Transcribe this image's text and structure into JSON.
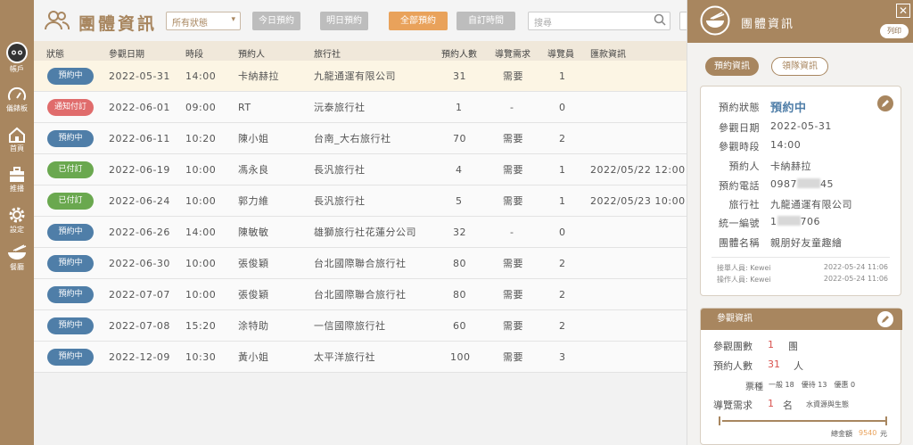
{
  "sidebar": {
    "items": [
      {
        "label": "帳戶"
      },
      {
        "label": "儀錶板"
      },
      {
        "label": "首頁"
      },
      {
        "label": "推播"
      },
      {
        "label": "設定"
      },
      {
        "label": "餐廳"
      }
    ]
  },
  "header": {
    "title": "團體資訊",
    "status_filter": "所有狀態",
    "filters": [
      "今日預約",
      "明日預約",
      "全部預約",
      "自訂時間"
    ],
    "search_placeholder": "搜尋"
  },
  "table": {
    "columns": [
      "狀態",
      "參觀日期",
      "時段",
      "預約人",
      "旅行社",
      "預約人數",
      "導覽需求",
      "導覽員",
      "匯款資訊"
    ],
    "rows": [
      {
        "status": "預約中",
        "status_color": "#4f7ea8",
        "date": "2022-05-31",
        "time": "14:00",
        "person": "卡納赫拉",
        "agency": "九龍通運有限公司",
        "count": "31",
        "guide_need": "需要",
        "guides": "1",
        "remit": ""
      },
      {
        "status": "通知付訂",
        "status_color": "#e06c6c",
        "date": "2022-06-01",
        "time": "09:00",
        "person": "RT",
        "agency": "沅泰旅行社",
        "count": "1",
        "guide_need": "-",
        "guides": "0",
        "remit": ""
      },
      {
        "status": "預約中",
        "status_color": "#4f7ea8",
        "date": "2022-06-11",
        "time": "10:20",
        "person": "陳小姐",
        "agency": "台南_大右旅行社",
        "count": "70",
        "guide_need": "需要",
        "guides": "2",
        "remit": ""
      },
      {
        "status": "已付訂",
        "status_color": "#6aa84f",
        "date": "2022-06-19",
        "time": "10:00",
        "person": "馮永良",
        "agency": "長汎旅行社",
        "count": "4",
        "guide_need": "需要",
        "guides": "1",
        "remit": "2022/05/22 12:00"
      },
      {
        "status": "已付訂",
        "status_color": "#6aa84f",
        "date": "2022-06-24",
        "time": "10:00",
        "person": "郭力維",
        "agency": "長汎旅行社",
        "count": "5",
        "guide_need": "需要",
        "guides": "1",
        "remit": "2022/05/23 10:00"
      },
      {
        "status": "預約中",
        "status_color": "#4f7ea8",
        "date": "2022-06-26",
        "time": "14:00",
        "person": "陳敏敏",
        "agency": "雄獅旅行社花蓮分公司",
        "count": "32",
        "guide_need": "-",
        "guides": "0",
        "remit": ""
      },
      {
        "status": "預約中",
        "status_color": "#4f7ea8",
        "date": "2022-06-30",
        "time": "10:00",
        "person": "張俊穎",
        "agency": "台北國際聯合旅行社",
        "count": "80",
        "guide_need": "需要",
        "guides": "2",
        "remit": ""
      },
      {
        "status": "預約中",
        "status_color": "#4f7ea8",
        "date": "2022-07-07",
        "time": "10:00",
        "person": "張俊穎",
        "agency": "台北國際聯合旅行社",
        "count": "80",
        "guide_need": "需要",
        "guides": "2",
        "remit": ""
      },
      {
        "status": "預約中",
        "status_color": "#4f7ea8",
        "date": "2022-07-08",
        "time": "15:20",
        "person": "涂特助",
        "agency": "一信國際旅行社",
        "count": "60",
        "guide_need": "需要",
        "guides": "2",
        "remit": ""
      },
      {
        "status": "預約中",
        "status_color": "#4f7ea8",
        "date": "2022-12-09",
        "time": "10:30",
        "person": "黃小姐",
        "agency": "太平洋旅行社",
        "count": "100",
        "guide_need": "需要",
        "guides": "3",
        "remit": ""
      }
    ]
  },
  "panel": {
    "title": "團體資訊",
    "print_label": "列印",
    "tabs": [
      "預約資訊",
      "領隊資訊"
    ],
    "info": {
      "status_label": "預約狀態",
      "status_value": "預約中",
      "date_label": "參觀日期",
      "date_value": "2022-05-31",
      "time_label": "參觀時段",
      "time_value": "14:00",
      "person_label": "預約人",
      "person_value": "卡納赫拉",
      "phone_label": "預約電話",
      "phone_prefix": "0987",
      "phone_suffix": "45",
      "agency_label": "旅行社",
      "agency_value": "九龍通運有限公司",
      "taxid_label": "統一編號",
      "taxid_prefix": "1",
      "taxid_suffix": "706",
      "group_label": "團體名稱",
      "group_value": "親朋好友童趣繪"
    },
    "meta": {
      "receiver": "接單人員: Kewei",
      "receiver_time": "2022-05-24 11:06",
      "operator": "操作人員: Kewei",
      "operator_time": "2022-05-24 11:06"
    },
    "visit": {
      "header": "參觀資訊",
      "groups_label": "參觀團數",
      "groups_value": "1",
      "groups_unit": "團",
      "people_label": "預約人數",
      "people_value": "31",
      "people_unit": "人",
      "ticket_label": "票種",
      "ticket_detail": "一般 18　優待 13　優惠 0",
      "guide_label": "導覽需求",
      "guide_value": "1",
      "guide_unit": "名",
      "guide_topic": "水資源與生態",
      "total_label": "總金額",
      "total_value": "9540",
      "total_unit": "元"
    }
  }
}
